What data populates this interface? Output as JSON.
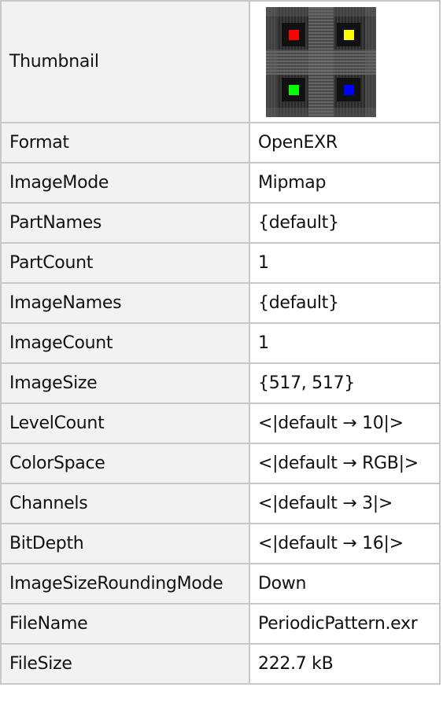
{
  "properties": {
    "thumbnail_label": "Thumbnail",
    "thumbnail_dot_colors": [
      "#ff0000",
      "#ffff00",
      "#00ff00",
      "#0000ff"
    ],
    "rows": [
      {
        "key": "Format",
        "value": "OpenEXR"
      },
      {
        "key": "ImageMode",
        "value": "Mipmap"
      },
      {
        "key": "PartNames",
        "value": "{default}"
      },
      {
        "key": "PartCount",
        "value": "1"
      },
      {
        "key": "ImageNames",
        "value": "{default}"
      },
      {
        "key": "ImageCount",
        "value": "1"
      },
      {
        "key": "ImageSize",
        "value": "{517, 517}"
      },
      {
        "key": "LevelCount",
        "value": "<|default → 10|>"
      },
      {
        "key": "ColorSpace",
        "value": "<|default → RGB|>"
      },
      {
        "key": "Channels",
        "value": "<|default → 3|>"
      },
      {
        "key": "BitDepth",
        "value": "<|default → 16|>"
      },
      {
        "key": "ImageSizeRoundingMode",
        "value": "Down"
      },
      {
        "key": "FileName",
        "value": "PeriodicPattern.exr"
      },
      {
        "key": "FileSize",
        "value": "222.7 kB"
      }
    ]
  }
}
